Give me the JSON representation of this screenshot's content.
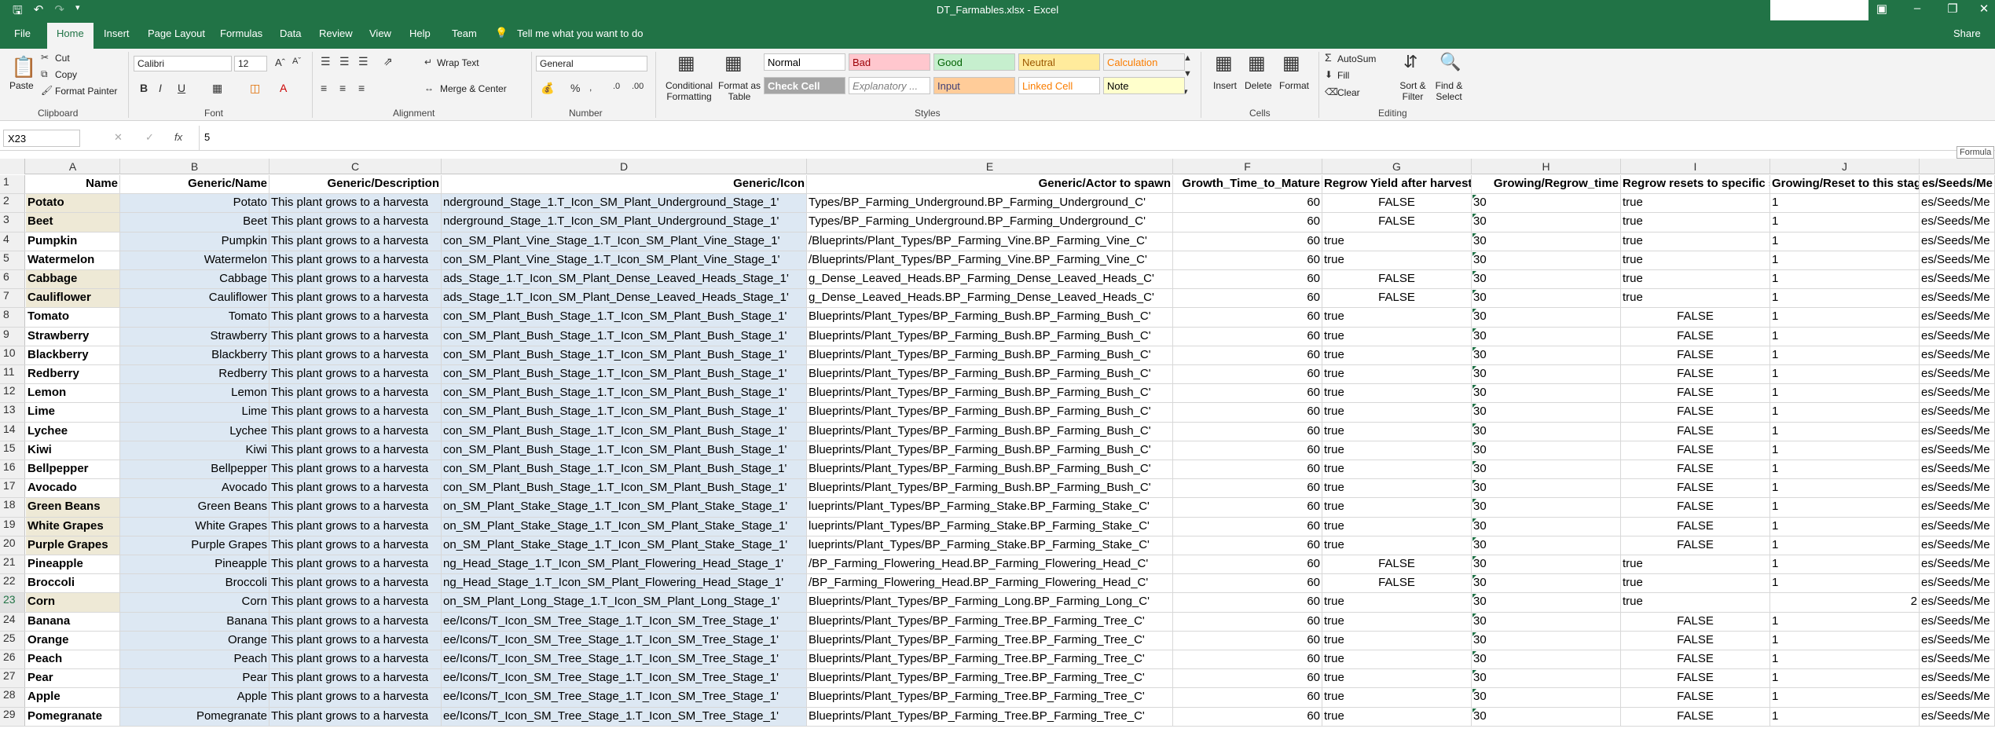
{
  "window": {
    "title": "DT_Farmables.xlsx  -  Excel"
  },
  "tabs": [
    "File",
    "Home",
    "Insert",
    "Page Layout",
    "Formulas",
    "Data",
    "Review",
    "View",
    "Help",
    "Team"
  ],
  "tell_me": "Tell me what you want to do",
  "share_label": "Share",
  "ribbon": {
    "clipboard": {
      "paste": "Paste",
      "cut": "Cut",
      "copy": "Copy",
      "format_painter": "Format Painter",
      "label": "Clipboard"
    },
    "font": {
      "name": "Calibri",
      "size": "12",
      "label": "Font"
    },
    "alignment": {
      "wrap": "Wrap Text",
      "merge": "Merge & Center",
      "label": "Alignment"
    },
    "number": {
      "format": "General",
      "label": "Number"
    },
    "styles": {
      "conditional": "Conditional Formatting",
      "format_table": "Format as Table",
      "cells": [
        {
          "label": "Normal",
          "bg": "#ffffff",
          "fg": "#000000"
        },
        {
          "label": "Bad",
          "bg": "#ffc7ce",
          "fg": "#9c0006"
        },
        {
          "label": "Good",
          "bg": "#c6efce",
          "fg": "#006100"
        },
        {
          "label": "Neutral",
          "bg": "#ffeb9c",
          "fg": "#9c5700"
        },
        {
          "label": "Calculation",
          "bg": "#f2f2f2",
          "fg": "#fa7d00"
        },
        {
          "label": "Check Cell",
          "bg": "#a5a5a5",
          "fg": "#ffffff"
        },
        {
          "label": "Explanatory ...",
          "bg": "#ffffff",
          "fg": "#7f7f7f"
        },
        {
          "label": "Input",
          "bg": "#ffcc99",
          "fg": "#3f3f76"
        },
        {
          "label": "Linked Cell",
          "bg": "#ffffff",
          "fg": "#fa7d00"
        },
        {
          "label": "Note",
          "bg": "#ffffcc",
          "fg": "#000000"
        }
      ],
      "label": "Styles"
    },
    "cells_group": {
      "insert": "Insert",
      "delete": "Delete",
      "format": "Format",
      "label": "Cells"
    },
    "editing": {
      "autosum": "AutoSum",
      "fill": "Fill",
      "clear": "Clear",
      "sort": "Sort & Filter",
      "find": "Find & Select",
      "label": "Editing"
    }
  },
  "formula_bar": {
    "name_box": "X23",
    "value": "5",
    "side_tab": "Formula"
  },
  "columns": [
    "A",
    "B",
    "C",
    "D",
    "E",
    "F",
    "G",
    "H",
    "I",
    "J"
  ],
  "header_row": {
    "A": "Name",
    "B": "Generic/Name",
    "C": "Generic/Description",
    "D": "Generic/Icon",
    "E": "Generic/Actor to spawn",
    "F": "Growth_Time_to_Mature",
    "G": "Regrow Yield after harvest",
    "H": "Growing/Regrow_time",
    "I": "Regrow resets to specific stage",
    "J": "Growing/Reset to this stage",
    "K": "es/Seeds/Me"
  },
  "rows": [
    {
      "n": "2",
      "A": "Potato",
      "B": "Potato",
      "C": "This plant grows to a harvesta",
      "D": "nderground_Stage_1.T_Icon_SM_Plant_Underground_Stage_1'",
      "E": "Types/BP_Farming_Underground.BP_Farming_Underground_C'",
      "F": "60",
      "G": "FALSE",
      "H": "30",
      "I": "true",
      "J": "1",
      "K": "es/Seeds/Me",
      "hl": true
    },
    {
      "n": "3",
      "A": "Beet",
      "B": "Beet",
      "C": "This plant grows to a harvesta",
      "D": "nderground_Stage_1.T_Icon_SM_Plant_Underground_Stage_1'",
      "E": "Types/BP_Farming_Underground.BP_Farming_Underground_C'",
      "F": "60",
      "G": "FALSE",
      "H": "30",
      "I": "true",
      "J": "1",
      "K": "es/Seeds/Me",
      "hl": true
    },
    {
      "n": "4",
      "A": "Pumpkin",
      "B": "Pumpkin",
      "C": "This plant grows to a harvesta",
      "D": "con_SM_Plant_Vine_Stage_1.T_Icon_SM_Plant_Vine_Stage_1'",
      "E": "/Blueprints/Plant_Types/BP_Farming_Vine.BP_Farming_Vine_C'",
      "F": "60",
      "G": "true",
      "H": "30",
      "I": "true",
      "J": "1",
      "K": "es/Seeds/Me",
      "hl": false
    },
    {
      "n": "5",
      "A": "Watermelon",
      "B": "Watermelon",
      "C": "This plant grows to a harvesta",
      "D": "con_SM_Plant_Vine_Stage_1.T_Icon_SM_Plant_Vine_Stage_1'",
      "E": "/Blueprints/Plant_Types/BP_Farming_Vine.BP_Farming_Vine_C'",
      "F": "60",
      "G": "true",
      "H": "30",
      "I": "true",
      "J": "1",
      "K": "es/Seeds/Me",
      "hl": false
    },
    {
      "n": "6",
      "A": "Cabbage",
      "B": "Cabbage",
      "C": "This plant grows to a harvesta",
      "D": "ads_Stage_1.T_Icon_SM_Plant_Dense_Leaved_Heads_Stage_1'",
      "E": "g_Dense_Leaved_Heads.BP_Farming_Dense_Leaved_Heads_C'",
      "F": "60",
      "G": "FALSE",
      "H": "30",
      "I": "true",
      "J": "1",
      "K": "es/Seeds/Me",
      "hl": true
    },
    {
      "n": "7",
      "A": "Cauliflower",
      "B": "Cauliflower",
      "C": "This plant grows to a harvesta",
      "D": "ads_Stage_1.T_Icon_SM_Plant_Dense_Leaved_Heads_Stage_1'",
      "E": "g_Dense_Leaved_Heads.BP_Farming_Dense_Leaved_Heads_C'",
      "F": "60",
      "G": "FALSE",
      "H": "30",
      "I": "true",
      "J": "1",
      "K": "es/Seeds/Me",
      "hl": true
    },
    {
      "n": "8",
      "A": "Tomato",
      "B": "Tomato",
      "C": "This plant grows to a harvesta",
      "D": "con_SM_Plant_Bush_Stage_1.T_Icon_SM_Plant_Bush_Stage_1'",
      "E": "Blueprints/Plant_Types/BP_Farming_Bush.BP_Farming_Bush_C'",
      "F": "60",
      "G": "true",
      "H": "30",
      "I": "FALSE",
      "J": "1",
      "K": "es/Seeds/Me",
      "hl": false
    },
    {
      "n": "9",
      "A": "Strawberry",
      "B": "Strawberry",
      "C": "This plant grows to a harvesta",
      "D": "con_SM_Plant_Bush_Stage_1.T_Icon_SM_Plant_Bush_Stage_1'",
      "E": "Blueprints/Plant_Types/BP_Farming_Bush.BP_Farming_Bush_C'",
      "F": "60",
      "G": "true",
      "H": "30",
      "I": "FALSE",
      "J": "1",
      "K": "es/Seeds/Me",
      "hl": false
    },
    {
      "n": "10",
      "A": "Blackberry",
      "B": "Blackberry",
      "C": "This plant grows to a harvesta",
      "D": "con_SM_Plant_Bush_Stage_1.T_Icon_SM_Plant_Bush_Stage_1'",
      "E": "Blueprints/Plant_Types/BP_Farming_Bush.BP_Farming_Bush_C'",
      "F": "60",
      "G": "true",
      "H": "30",
      "I": "FALSE",
      "J": "1",
      "K": "es/Seeds/Me",
      "hl": false
    },
    {
      "n": "11",
      "A": "Redberry",
      "B": "Redberry",
      "C": "This plant grows to a harvesta",
      "D": "con_SM_Plant_Bush_Stage_1.T_Icon_SM_Plant_Bush_Stage_1'",
      "E": "Blueprints/Plant_Types/BP_Farming_Bush.BP_Farming_Bush_C'",
      "F": "60",
      "G": "true",
      "H": "30",
      "I": "FALSE",
      "J": "1",
      "K": "es/Seeds/Me",
      "hl": false
    },
    {
      "n": "12",
      "A": "Lemon",
      "B": "Lemon",
      "C": "This plant grows to a harvesta",
      "D": "con_SM_Plant_Bush_Stage_1.T_Icon_SM_Plant_Bush_Stage_1'",
      "E": "Blueprints/Plant_Types/BP_Farming_Bush.BP_Farming_Bush_C'",
      "F": "60",
      "G": "true",
      "H": "30",
      "I": "FALSE",
      "J": "1",
      "K": "es/Seeds/Me",
      "hl": false
    },
    {
      "n": "13",
      "A": "Lime",
      "B": "Lime",
      "C": "This plant grows to a harvesta",
      "D": "con_SM_Plant_Bush_Stage_1.T_Icon_SM_Plant_Bush_Stage_1'",
      "E": "Blueprints/Plant_Types/BP_Farming_Bush.BP_Farming_Bush_C'",
      "F": "60",
      "G": "true",
      "H": "30",
      "I": "FALSE",
      "J": "1",
      "K": "es/Seeds/Me",
      "hl": false
    },
    {
      "n": "14",
      "A": "Lychee",
      "B": "Lychee",
      "C": "This plant grows to a harvesta",
      "D": "con_SM_Plant_Bush_Stage_1.T_Icon_SM_Plant_Bush_Stage_1'",
      "E": "Blueprints/Plant_Types/BP_Farming_Bush.BP_Farming_Bush_C'",
      "F": "60",
      "G": "true",
      "H": "30",
      "I": "FALSE",
      "J": "1",
      "K": "es/Seeds/Me",
      "hl": false
    },
    {
      "n": "15",
      "A": "Kiwi",
      "B": "Kiwi",
      "C": "This plant grows to a harvesta",
      "D": "con_SM_Plant_Bush_Stage_1.T_Icon_SM_Plant_Bush_Stage_1'",
      "E": "Blueprints/Plant_Types/BP_Farming_Bush.BP_Farming_Bush_C'",
      "F": "60",
      "G": "true",
      "H": "30",
      "I": "FALSE",
      "J": "1",
      "K": "es/Seeds/Me",
      "hl": false
    },
    {
      "n": "16",
      "A": "Bellpepper",
      "B": "Bellpepper",
      "C": "This plant grows to a harvesta",
      "D": "con_SM_Plant_Bush_Stage_1.T_Icon_SM_Plant_Bush_Stage_1'",
      "E": "Blueprints/Plant_Types/BP_Farming_Bush.BP_Farming_Bush_C'",
      "F": "60",
      "G": "true",
      "H": "30",
      "I": "FALSE",
      "J": "1",
      "K": "es/Seeds/Me",
      "hl": false
    },
    {
      "n": "17",
      "A": "Avocado",
      "B": "Avocado",
      "C": "This plant grows to a harvesta",
      "D": "con_SM_Plant_Bush_Stage_1.T_Icon_SM_Plant_Bush_Stage_1'",
      "E": "Blueprints/Plant_Types/BP_Farming_Bush.BP_Farming_Bush_C'",
      "F": "60",
      "G": "true",
      "H": "30",
      "I": "FALSE",
      "J": "1",
      "K": "es/Seeds/Me",
      "hl": false
    },
    {
      "n": "18",
      "A": "Green Beans",
      "B": "Green Beans",
      "C": "This plant grows to a harvesta",
      "D": "on_SM_Plant_Stake_Stage_1.T_Icon_SM_Plant_Stake_Stage_1'",
      "E": "lueprints/Plant_Types/BP_Farming_Stake.BP_Farming_Stake_C'",
      "F": "60",
      "G": "true",
      "H": "30",
      "I": "FALSE",
      "J": "1",
      "K": "es/Seeds/Me",
      "hl": true
    },
    {
      "n": "19",
      "A": "White Grapes",
      "B": "White Grapes",
      "C": "This plant grows to a harvesta",
      "D": "on_SM_Plant_Stake_Stage_1.T_Icon_SM_Plant_Stake_Stage_1'",
      "E": "lueprints/Plant_Types/BP_Farming_Stake.BP_Farming_Stake_C'",
      "F": "60",
      "G": "true",
      "H": "30",
      "I": "FALSE",
      "J": "1",
      "K": "es/Seeds/Me",
      "hl": true
    },
    {
      "n": "20",
      "A": "Purple Grapes",
      "B": "Purple Grapes",
      "C": "This plant grows to a harvesta",
      "D": "on_SM_Plant_Stake_Stage_1.T_Icon_SM_Plant_Stake_Stage_1'",
      "E": "lueprints/Plant_Types/BP_Farming_Stake.BP_Farming_Stake_C'",
      "F": "60",
      "G": "true",
      "H": "30",
      "I": "FALSE",
      "J": "1",
      "K": "es/Seeds/Me",
      "hl": true
    },
    {
      "n": "21",
      "A": "Pineapple",
      "B": "Pineapple",
      "C": "This plant grows to a harvesta",
      "D": "ng_Head_Stage_1.T_Icon_SM_Plant_Flowering_Head_Stage_1'",
      "E": "/BP_Farming_Flowering_Head.BP_Farming_Flowering_Head_C'",
      "F": "60",
      "G": "FALSE",
      "H": "30",
      "I": "true",
      "J": "1",
      "K": "es/Seeds/Me",
      "hl": false
    },
    {
      "n": "22",
      "A": "Broccoli",
      "B": "Broccoli",
      "C": "This plant grows to a harvesta",
      "D": "ng_Head_Stage_1.T_Icon_SM_Plant_Flowering_Head_Stage_1'",
      "E": "/BP_Farming_Flowering_Head.BP_Farming_Flowering_Head_C'",
      "F": "60",
      "G": "FALSE",
      "H": "30",
      "I": "true",
      "J": "1",
      "K": "es/Seeds/Me",
      "hl": false
    },
    {
      "n": "23",
      "A": "Corn",
      "B": "Corn",
      "C": "This plant grows to a harvesta",
      "D": "on_SM_Plant_Long_Stage_1.T_Icon_SM_Plant_Long_Stage_1'",
      "E": "Blueprints/Plant_Types/BP_Farming_Long.BP_Farming_Long_C'",
      "F": "60",
      "G": "true",
      "H": "30",
      "I": "true",
      "J": "2",
      "K": "es/Seeds/Me",
      "hl": true,
      "sel": true
    },
    {
      "n": "24",
      "A": "Banana",
      "B": "Banana",
      "C": "This plant grows to a harvesta",
      "D": "ee/Icons/T_Icon_SM_Tree_Stage_1.T_Icon_SM_Tree_Stage_1'",
      "E": "Blueprints/Plant_Types/BP_Farming_Tree.BP_Farming_Tree_C'",
      "F": "60",
      "G": "true",
      "H": "30",
      "I": "FALSE",
      "J": "1",
      "K": "es/Seeds/Me",
      "hl": false
    },
    {
      "n": "25",
      "A": "Orange",
      "B": "Orange",
      "C": "This plant grows to a harvesta",
      "D": "ee/Icons/T_Icon_SM_Tree_Stage_1.T_Icon_SM_Tree_Stage_1'",
      "E": "Blueprints/Plant_Types/BP_Farming_Tree.BP_Farming_Tree_C'",
      "F": "60",
      "G": "true",
      "H": "30",
      "I": "FALSE",
      "J": "1",
      "K": "es/Seeds/Me",
      "hl": false
    },
    {
      "n": "26",
      "A": "Peach",
      "B": "Peach",
      "C": "This plant grows to a harvesta",
      "D": "ee/Icons/T_Icon_SM_Tree_Stage_1.T_Icon_SM_Tree_Stage_1'",
      "E": "Blueprints/Plant_Types/BP_Farming_Tree.BP_Farming_Tree_C'",
      "F": "60",
      "G": "true",
      "H": "30",
      "I": "FALSE",
      "J": "1",
      "K": "es/Seeds/Me",
      "hl": false
    },
    {
      "n": "27",
      "A": "Pear",
      "B": "Pear",
      "C": "This plant grows to a harvesta",
      "D": "ee/Icons/T_Icon_SM_Tree_Stage_1.T_Icon_SM_Tree_Stage_1'",
      "E": "Blueprints/Plant_Types/BP_Farming_Tree.BP_Farming_Tree_C'",
      "F": "60",
      "G": "true",
      "H": "30",
      "I": "FALSE",
      "J": "1",
      "K": "es/Seeds/Me",
      "hl": false
    },
    {
      "n": "28",
      "A": "Apple",
      "B": "Apple",
      "C": "This plant grows to a harvesta",
      "D": "ee/Icons/T_Icon_SM_Tree_Stage_1.T_Icon_SM_Tree_Stage_1'",
      "E": "Blueprints/Plant_Types/BP_Farming_Tree.BP_Farming_Tree_C'",
      "F": "60",
      "G": "true",
      "H": "30",
      "I": "FALSE",
      "J": "1",
      "K": "es/Seeds/Me",
      "hl": false
    },
    {
      "n": "29",
      "A": "Pomegranate",
      "B": "Pomegranate",
      "C": "This plant grows to a harvesta",
      "D": "ee/Icons/T_Icon_SM_Tree_Stage_1.T_Icon_SM_Tree_Stage_1'",
      "E": "Blueprints/Plant_Types/BP_Farming_Tree.BP_Farming_Tree_C'",
      "F": "60",
      "G": "true",
      "H": "30",
      "I": "FALSE",
      "J": "1",
      "K": "es/Seeds/Me",
      "hl": false
    }
  ]
}
